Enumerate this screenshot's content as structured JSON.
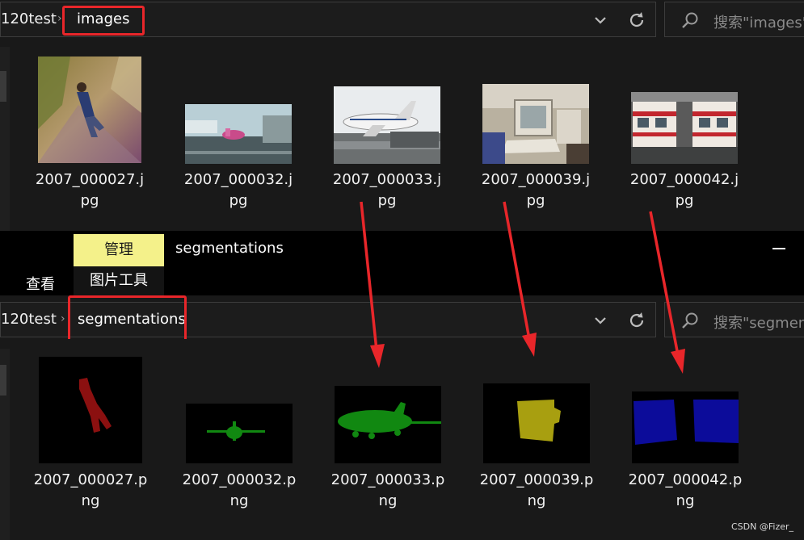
{
  "top_window": {
    "breadcrumb_root": "120test",
    "breadcrumb_sep": "›",
    "breadcrumb_current": "images",
    "search_placeholder": "搜索\"images\"",
    "files": [
      {
        "line1": "2007_000027.j",
        "line2": "pg"
      },
      {
        "line1": "2007_000032.j",
        "line2": "pg"
      },
      {
        "line1": "2007_000033.j",
        "line2": "pg"
      },
      {
        "line1": "2007_000039.j",
        "line2": "pg"
      },
      {
        "line1": "2007_000042.j",
        "line2": "pg"
      }
    ]
  },
  "ribbon": {
    "manage_tab": "管理",
    "title": "segmentations",
    "view_tab": "查看",
    "picture_tools_tab": "图片工具"
  },
  "bottom_window": {
    "breadcrumb_root": "120test",
    "breadcrumb_sep": "›",
    "breadcrumb_current": "segmentations",
    "search_placeholder": "搜索\"segmen",
    "files": [
      {
        "line1": "2007_000027.p",
        "line2": "ng"
      },
      {
        "line1": "2007_000032.p",
        "line2": "ng"
      },
      {
        "line1": "2007_000033.p",
        "line2": "ng"
      },
      {
        "line1": "2007_000039.p",
        "line2": "ng"
      },
      {
        "line1": "2007_000042.p",
        "line2": "ng"
      }
    ]
  },
  "watermark": "CSDN @Fizer_",
  "colors": {
    "highlight_box": "#e8262a",
    "arrow": "#e8262a",
    "manage_tab_bg": "#f4f18a",
    "mask_person": "#8b1010",
    "mask_aeroplane": "#118811",
    "mask_monitor": "#a89f10",
    "mask_train": "#0c0c9a"
  }
}
